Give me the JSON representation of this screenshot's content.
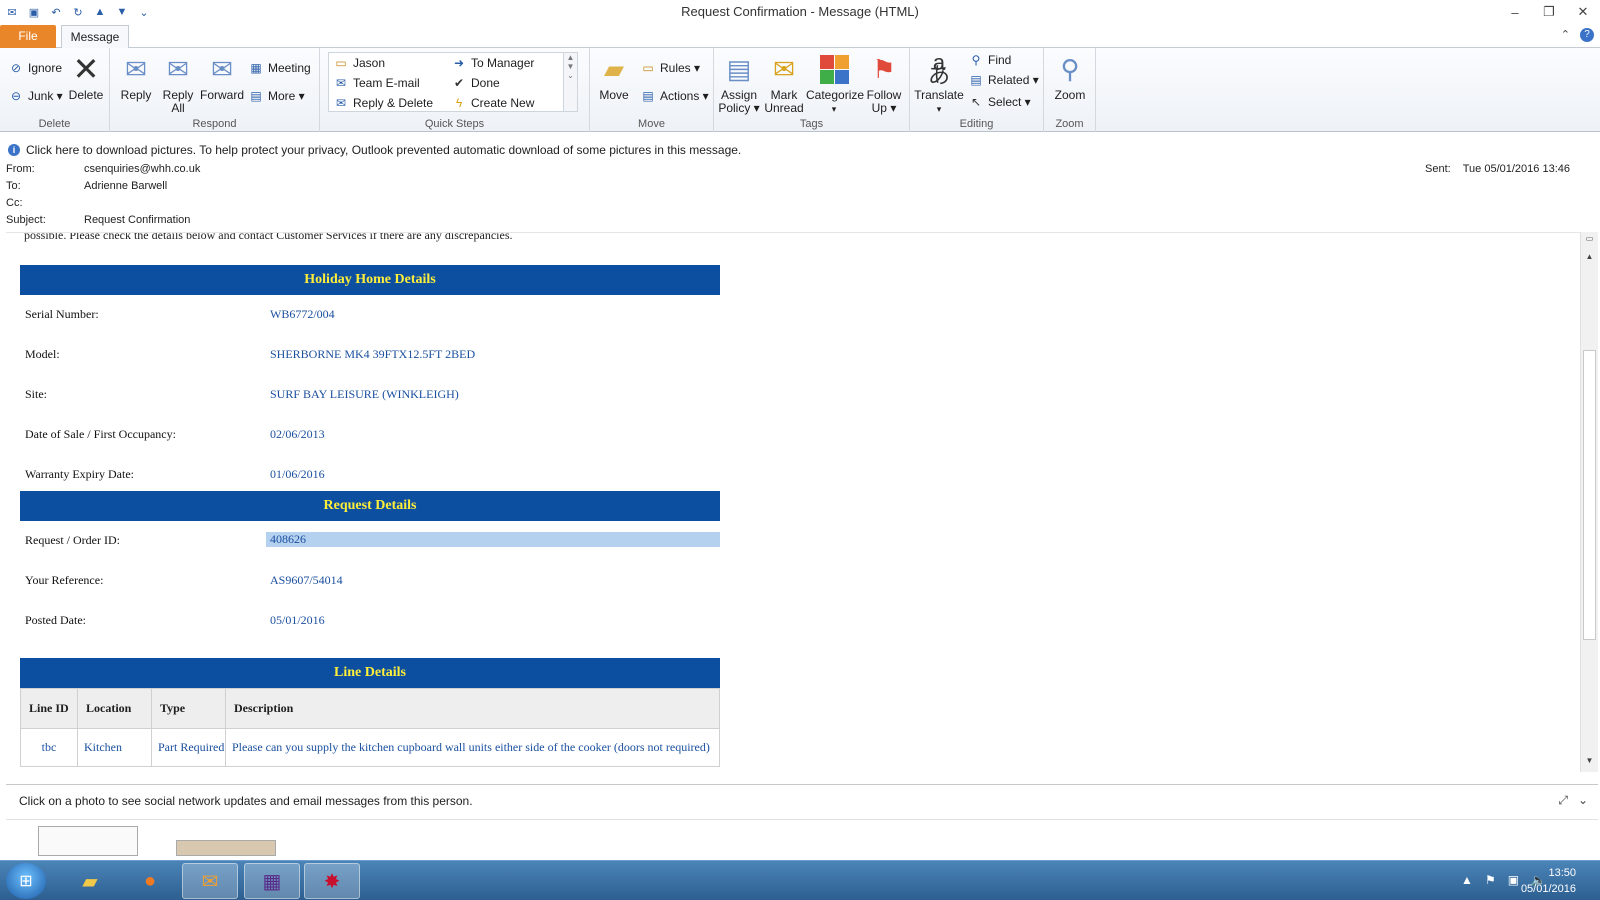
{
  "window": {
    "title": "Request Confirmation  -  Message (HTML)",
    "controls": [
      "–",
      "❐",
      "✕"
    ]
  },
  "tabs": {
    "file": "File",
    "message": "Message"
  },
  "ribbon": {
    "delete_group": {
      "label": "Delete",
      "ignore": "Ignore",
      "junk": "Junk ▾",
      "delete": "Delete"
    },
    "respond_group": {
      "label": "Respond",
      "reply": "Reply",
      "reply_all_1": "Reply",
      "reply_all_2": "All",
      "forward": "Forward",
      "meeting": "Meeting",
      "more": "More ▾"
    },
    "quick_steps": {
      "label": "Quick Steps",
      "items": [
        "Jason",
        "To Manager",
        "Team E-mail",
        "Done",
        "Reply & Delete",
        "Create New"
      ]
    },
    "move_group": {
      "label": "Move",
      "move": "Move",
      "rules": "Rules ▾",
      "actions": "Actions ▾"
    },
    "tags_group": {
      "label": "Tags",
      "assign_1": "Assign",
      "assign_2": "Policy ▾",
      "mark_1": "Mark",
      "mark_2": "Unread",
      "categorize": "Categorize",
      "follow_1": "Follow",
      "follow_2": "Up ▾"
    },
    "editing_group": {
      "label": "Editing",
      "translate": "Translate",
      "find": "Find",
      "related": "Related ▾",
      "select": "Select ▾"
    },
    "zoom_group": {
      "label": "Zoom",
      "zoom": "Zoom"
    }
  },
  "infobar": {
    "text": "Click here to download pictures. To help protect your privacy, Outlook prevented automatic download of some pictures in this message."
  },
  "headers": {
    "from_label": "From:",
    "from": "csenquiries@whh.co.uk",
    "to_label": "To:",
    "to": "Adrienne Barwell",
    "cc_label": "Cc:",
    "cc": "",
    "subject_label": "Subject:",
    "subject": "Request Confirmation",
    "sent_label": "Sent:",
    "sent": "Tue 05/01/2016 13:46"
  },
  "body": {
    "cut_text": "possible. Please check the details below and contact Customer Services if there are any discrepancies.",
    "holiday": {
      "title": "Holiday Home Details",
      "rows": [
        {
          "k": "Serial Number:",
          "v": "WB6772/004"
        },
        {
          "k": "Model:",
          "v": "SHERBORNE MK4 39FTX12.5FT 2BED"
        },
        {
          "k": "Site:",
          "v": "SURF BAY LEISURE (WINKLEIGH)"
        },
        {
          "k": "Date of Sale / First Occupancy:",
          "v": "02/06/2013"
        },
        {
          "k": "Warranty Expiry Date:",
          "v": "01/06/2016"
        }
      ]
    },
    "request": {
      "title": "Request Details",
      "rows": [
        {
          "k": "Request / Order ID:",
          "v": "408626"
        },
        {
          "k": "Your Reference:",
          "v": "AS9607/54014"
        },
        {
          "k": "Posted Date:",
          "v": "05/01/2016"
        }
      ]
    },
    "lines": {
      "title": "Line Details",
      "headers": [
        "Line ID",
        "Location",
        "Type",
        "Description"
      ],
      "rows": [
        [
          "tbc",
          "Kitchen",
          "Part Required",
          "Please can you supply the kitchen cupboard wall units either side of the cooker (doors not required)"
        ]
      ]
    }
  },
  "people_pane": {
    "text": "Click on a photo to see social network updates and email messages from this person."
  },
  "taskbar": {
    "time": "13:50",
    "date": "05/01/2016"
  }
}
